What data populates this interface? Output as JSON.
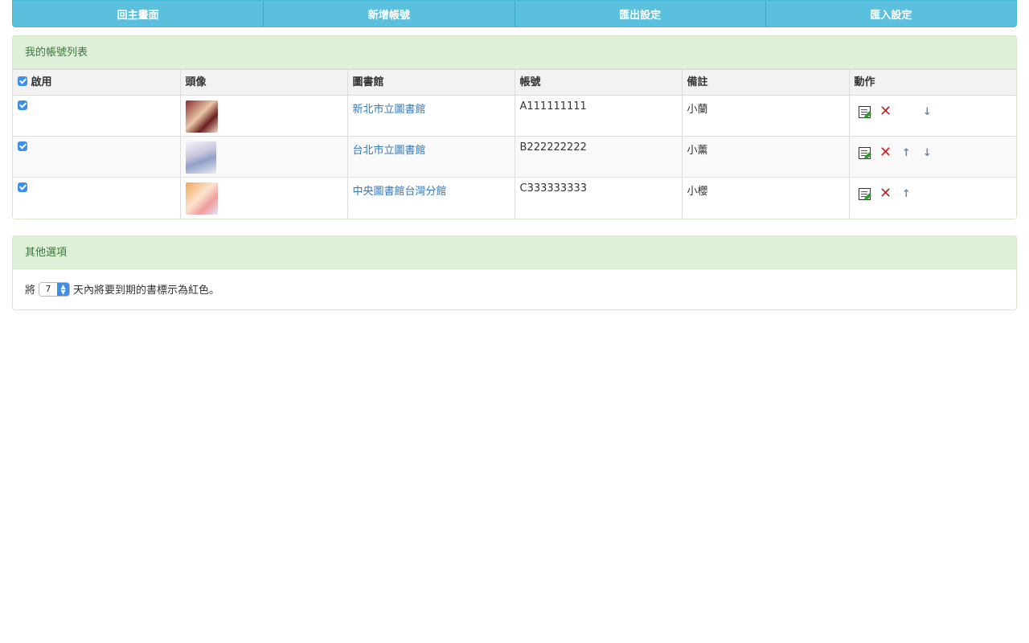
{
  "nav": {
    "items": [
      "回主畫面",
      "新增帳號",
      "匯出設定",
      "匯入設定"
    ]
  },
  "accounts_panel": {
    "title": "我的帳號列表",
    "columns": {
      "enable": "啟用",
      "avatar": "頭像",
      "library": "圖書館",
      "account": "帳號",
      "note": "備註",
      "actions": "動作"
    },
    "rows": [
      {
        "enabled": true,
        "library": "新北市立圖書館",
        "account": "A111111111",
        "note": "小蘭"
      },
      {
        "enabled": true,
        "library": "台北市立圖書館",
        "account": "B222222222",
        "note": "小薰"
      },
      {
        "enabled": true,
        "library": "中央圖書館台灣分館",
        "account": "C333333333",
        "note": "小櫻"
      }
    ]
  },
  "options_panel": {
    "title": "其他選項",
    "prefix": "將",
    "days_value": "7",
    "suffix": "天內將要到期的書標示為紅色。"
  },
  "colors": {
    "nav_bg": "#5bc0de",
    "panel_heading_bg": "#dff0d8",
    "link": "#337ab7",
    "checkbox": "#3b8eea"
  },
  "icons": [
    "edit-icon",
    "delete-icon",
    "move-up-icon",
    "move-down-icon"
  ]
}
